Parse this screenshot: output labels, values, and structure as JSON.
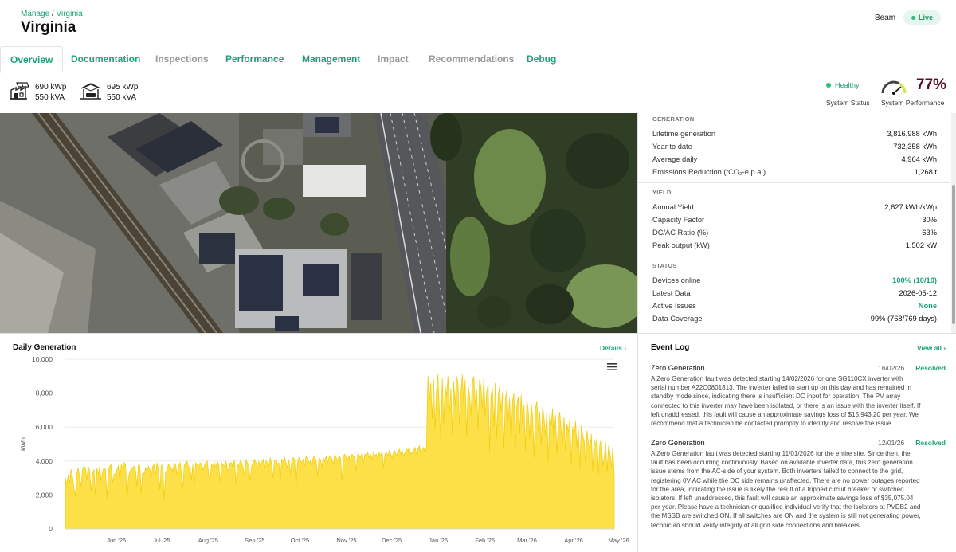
{
  "header": {
    "breadcrumb_root": "Manage",
    "breadcrumb_sep": "/",
    "breadcrumb_current": "Virginia",
    "title": "Virginia",
    "user": "Beam",
    "live_label": "Live"
  },
  "tabs": [
    {
      "label": "Overview",
      "active": true
    },
    {
      "label": "Documentation"
    },
    {
      "label": "Inspections"
    },
    {
      "label": "Performance"
    },
    {
      "label": "Management"
    },
    {
      "label": "Impact"
    },
    {
      "label": "Recommendations"
    },
    {
      "label": "Debug"
    }
  ],
  "capacity": [
    {
      "kwp": "690 kWp",
      "kva": "550 kVA",
      "icon": "factory-solar-icon"
    },
    {
      "kwp": "695 kWp",
      "kva": "550 kVA",
      "icon": "carport-solar-icon"
    }
  ],
  "system_status": {
    "value": "Healthy",
    "label": "System Status"
  },
  "system_performance": {
    "value": "77%",
    "label": "System Performance",
    "level": 0.77
  },
  "metrics": {
    "generation": {
      "title": "GENERATION",
      "rows": [
        {
          "label": "Lifetime generation",
          "value": "3,816,988 kWh"
        },
        {
          "label": "Year to date",
          "value": "732,358 kWh"
        },
        {
          "label": "Average daily",
          "value": "4,964 kWh"
        },
        {
          "label": "Emissions Reduction (tCO₂-e p.a.)",
          "value": "1,268 t"
        }
      ]
    },
    "yield": {
      "title": "YIELD",
      "rows": [
        {
          "label": "Annual Yield",
          "value": "2,627 kWh/kWp"
        },
        {
          "label": "Capacity Factor",
          "value": "30%"
        },
        {
          "label": "DC/AC Ratio (%)",
          "value": "63%"
        },
        {
          "label": "Peak output (kW)",
          "value": "1,502 kW"
        }
      ]
    },
    "status": {
      "title": "STATUS",
      "rows": [
        {
          "label": "Devices online",
          "value": "100% (10/10)",
          "highlight": true
        },
        {
          "label": "Latest Data",
          "value": "2026-05-12"
        },
        {
          "label": "Active Issues",
          "value": "None",
          "highlight": true
        },
        {
          "label": "Data Coverage",
          "value": "99% (768/769 days)"
        }
      ]
    }
  },
  "daily_generation": {
    "title": "Daily Generation",
    "details_link": "Details",
    "menu_icon": "hamburger-menu-icon"
  },
  "chart_data": {
    "type": "area",
    "title": "Daily Generation",
    "xlabel": "",
    "ylabel": "kWh",
    "ylim": [
      0,
      10000
    ],
    "yticks": [
      "0",
      "2,000",
      "4,000",
      "6,000",
      "8,000",
      "10,000"
    ],
    "xticks": [
      "Jun '25",
      "Jul '25",
      "Aug '25",
      "Sep '25",
      "Oct '25",
      "Nov '25",
      "Dec '25",
      "Jan '26",
      "Feb '26",
      "Mar '26",
      "Apr '26",
      "May '26"
    ],
    "x_start": "2025-05-12",
    "x_end": "2026-05-12",
    "color": "#fde047",
    "values": [
      3000,
      2600,
      3200,
      2700,
      3500,
      3100,
      2400,
      1900,
      3300,
      3600,
      3000,
      2500,
      3500,
      3700,
      3600,
      2900,
      3700,
      3400,
      2200,
      3300,
      3500,
      2000,
      3600,
      3200,
      3700,
      2800,
      3400,
      3600,
      3500,
      1800,
      3400,
      3700,
      3800,
      2700,
      3200,
      3300,
      3500,
      3700,
      2900,
      3800,
      3600,
      3900,
      3800,
      1600,
      3000,
      3400,
      3500,
      3600,
      3700,
      3500,
      2500,
      3800,
      3700,
      2100,
      3400,
      3200,
      3600,
      3400,
      3700,
      3500,
      3000,
      3700,
      3800,
      3200,
      3900,
      3500,
      2300,
      3700,
      3800,
      1700,
      3300,
      3500,
      3800,
      3700,
      3600,
      3400,
      3900,
      3800,
      3200,
      3700,
      3900,
      3300,
      2400,
      3800,
      3900,
      4000,
      3600,
      3700,
      2900,
      3800,
      2600,
      3900,
      3800,
      3600,
      3900,
      3800,
      3500,
      3700,
      3900,
      4000,
      3200,
      2900,
      3800,
      3700,
      3900,
      3600,
      4000,
      3800,
      2700,
      3900,
      3800,
      3700,
      4000,
      3600,
      3400,
      3900,
      3900,
      3600,
      4100,
      2600,
      3800,
      3700,
      4000,
      3900,
      3600,
      3200,
      4100,
      3900,
      3800,
      2800,
      3700,
      3900,
      4100,
      3900,
      3500,
      4000,
      3700,
      3900,
      4100,
      3600,
      4000,
      3900,
      3700,
      4200,
      3800,
      3000,
      4000,
      4100,
      3800,
      3900,
      2900,
      4100,
      4000,
      4200,
      3900,
      3600,
      4100,
      3200,
      4000,
      4200,
      4100,
      2500,
      3900,
      4200,
      4000,
      3900,
      4100,
      3700,
      4300,
      4100,
      3900,
      4000,
      3800,
      4200,
      4300,
      4000,
      3100,
      4200,
      4100,
      3600,
      4200,
      4000,
      4300,
      3900,
      4200,
      4300,
      4100,
      3800,
      4400,
      4200,
      4000,
      4300,
      4200,
      2800,
      4300,
      4400,
      4200,
      4100,
      4300,
      4000,
      4400,
      4300,
      4200,
      3400,
      4400,
      4300,
      4200,
      4500,
      3900,
      4400,
      4300,
      4500,
      4200,
      4400,
      4100,
      4500,
      4300,
      4400,
      4200,
      4500,
      4300,
      4600,
      3600,
      4400,
      4500,
      4300,
      4600,
      4400,
      4200,
      4500,
      4600,
      4300,
      4500,
      4700,
      4400,
      4600,
      4300,
      4500,
      4700,
      4600,
      4800,
      4400,
      4500,
      4600,
      4800,
      4400,
      4700,
      4900,
      4500,
      4600,
      4800,
      4500,
      4800,
      9000,
      7500,
      8600,
      6500,
      8800,
      5800,
      8200,
      9100,
      7000,
      5200,
      8900,
      6200,
      8500,
      7800,
      9000,
      6800,
      8300,
      5600,
      8700,
      7200,
      9000,
      8600,
      6100,
      8000,
      9100,
      7400,
      8800,
      5400,
      8500,
      7900,
      6700,
      8700,
      9000,
      7300,
      8200,
      5900,
      8800,
      8400,
      7100,
      8900,
      6600,
      8100,
      8500,
      4500,
      7800,
      8300,
      6000,
      8600,
      5300,
      7900,
      8400,
      6900,
      8000,
      4700,
      7600,
      8200,
      6400,
      7700,
      5000,
      7500,
      8000,
      4800,
      7200,
      7800,
      5600,
      7900,
      6200,
      7300,
      4600,
      7600,
      7000,
      5300,
      7400,
      6700,
      4200,
      7100,
      7500,
      5800,
      6900,
      4900,
      7200,
      6500,
      5500,
      7000,
      3900,
      6800,
      6100,
      7100,
      5200,
      6700,
      4400,
      6300,
      6900,
      5800,
      5000,
      6600,
      4600,
      6200,
      5700,
      6500,
      3800,
      6000,
      5400,
      6400,
      4800,
      5900,
      3600,
      6100,
      5500,
      5200,
      3900,
      5800,
      5000,
      4700,
      5600,
      3400,
      5300,
      4900,
      5400,
      3200,
      5000,
      5300,
      3700,
      4200,
      5100,
      3300,
      4900,
      4500,
      3600,
      4800,
      3100
    ],
    "grid": true,
    "legend": "none"
  },
  "event_log": {
    "title": "Event Log",
    "view_all": "View all",
    "events": [
      {
        "name": "Zero Generation",
        "date": "16/02/26",
        "status": "Resolved",
        "lines": [
          "A Zero Generation fault was detected starting 14/02/2026 for one SG110CX inverter with",
          "serial number A22C0801813. The inverter failed to start up on this day and has remained in",
          "standby mode since, indicating there is insufficient DC input for operation. The PV array",
          "connected to this inverter may have been isolated, or there is an issue with the inverter itself. If",
          "left unaddressed, this fault will cause an approximate savings loss of $15,943.20 per year. We",
          "recommend that a technician be contacted promptly to identify and resolve the issue."
        ]
      },
      {
        "name": "Zero Generation",
        "date": "12/01/26",
        "status": "Resolved",
        "lines": [
          "A Zero Generation fault was detected starting 11/01/2026 for the entire site. Since then, the",
          "fault has been occurring continuously. Based on available inverter data, this zero generation",
          "issue stems from the AC-side of your system. Both inverters failed to connect to the grid,",
          "registering 0V AC while the DC side remains unaffected. There are no power outages reported",
          "for the area, indicating the issue is likely the result of a tripped circuit breaker or switched",
          "isolators. If left unaddressed, this fault will cause an approximate savings loss of $35,075.04",
          "per year. Please have a technician or qualified individual verify that the isolators at PVDB2 and",
          "the MSSB are switched ON. If all switches are ON and the system is still not generating power,",
          "technician should verify integrity of all grid side connections and breakers."
        ]
      }
    ]
  }
}
